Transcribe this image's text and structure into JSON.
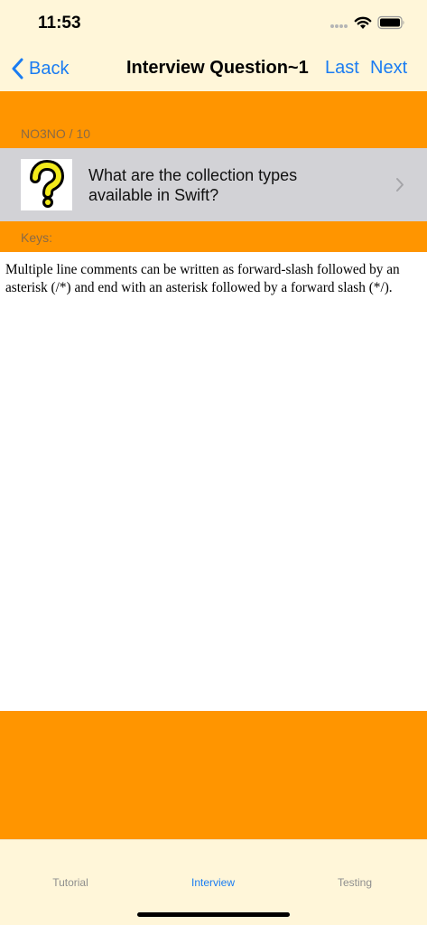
{
  "status_bar": {
    "time": "11:53",
    "icons": [
      "cellular-dots-icon",
      "wifi-icon",
      "battery-icon"
    ]
  },
  "nav": {
    "back_label": "Back",
    "title": "Interview Question~1",
    "last_label": "Last",
    "next_label": "Next"
  },
  "question": {
    "counter": "NO3NO / 10",
    "text": "What are the collection types available in Swift?",
    "icon": "question-mark-icon",
    "keys_label": "Keys:"
  },
  "answer": {
    "text": "Multiple line comments can be written as forward-slash followed by an asterisk (/*) and end with an asterisk followed by a forward slash (*/)."
  },
  "tabs": [
    {
      "label": "Tutorial",
      "selected": false
    },
    {
      "label": "Interview",
      "selected": true
    },
    {
      "label": "Testing",
      "selected": false
    }
  ],
  "colors": {
    "accent": "#1a7cf2",
    "orange": "#ff9500",
    "background": "#fff6d9",
    "row_gray": "#d2d2d6"
  }
}
